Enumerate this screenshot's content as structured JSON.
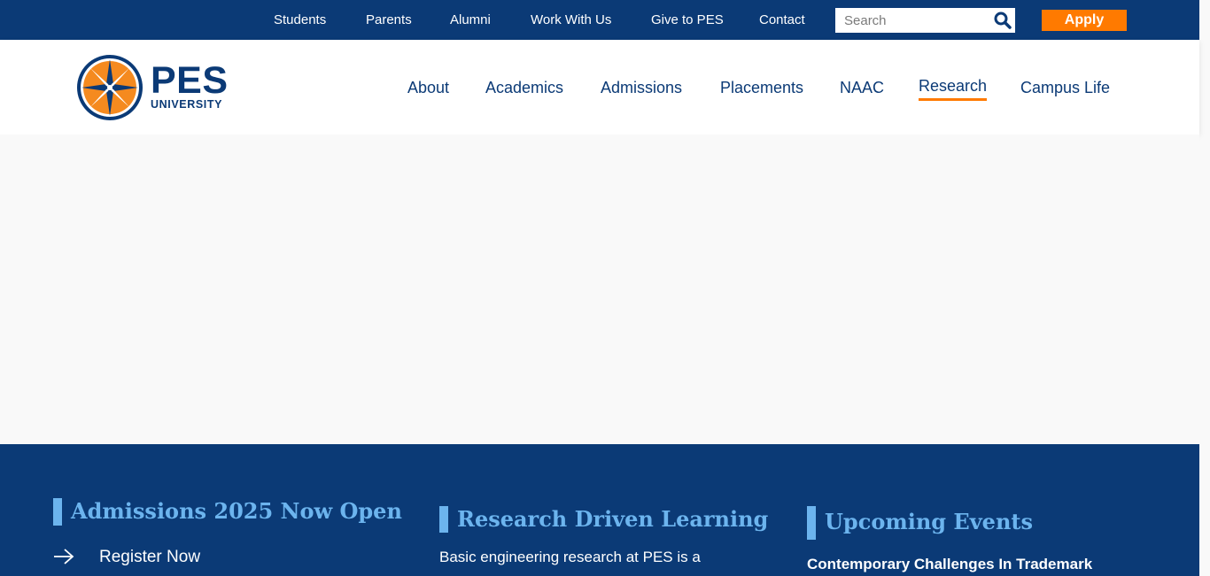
{
  "utility_nav": {
    "links": [
      "Students",
      "Parents",
      "Alumni",
      "Work With Us",
      "Give to PES",
      "Contact"
    ],
    "search_placeholder": "Search",
    "apply_label": "Apply"
  },
  "logo": {
    "name": "PES",
    "subtitle": "UNIVERSITY"
  },
  "main_nav": {
    "links": [
      "About",
      "Academics",
      "Admissions",
      "Placements",
      "NAAC",
      "Research",
      "Campus Life"
    ],
    "active": "Research"
  },
  "footer": {
    "admissions": {
      "title": "Admissions 2025 Now Open",
      "link": "Register Now"
    },
    "research": {
      "title": "Research Driven Learning",
      "text": "Basic engineering research at PES is a"
    },
    "events": {
      "title": "Upcoming Events",
      "item": "Contemporary Challenges In Trademark"
    }
  },
  "colors": {
    "navy": "#0b3a76",
    "orange": "#ff7a00",
    "light_blue": "#6cb4ee",
    "background": "#f9f9f9"
  }
}
